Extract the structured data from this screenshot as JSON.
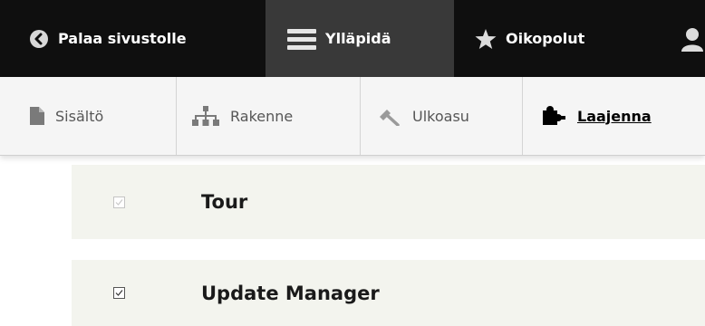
{
  "toolbar": {
    "back_label": "Palaa sivustolle",
    "admin_label": "Ylläpidä",
    "shortcuts_label": "Oikopolut"
  },
  "tray": {
    "items": [
      {
        "label": "Sisältö",
        "icon": "file-icon"
      },
      {
        "label": "Rakenne",
        "icon": "sitemap-icon"
      },
      {
        "label": "Ulkoasu",
        "icon": "wrench-icon"
      },
      {
        "label": "Laajenna",
        "icon": "puzzle-icon",
        "active": true
      }
    ]
  },
  "modules": [
    {
      "name": "Tour",
      "checked": true,
      "disabled": true
    },
    {
      "name": "Update Manager",
      "checked": true,
      "disabled": false
    }
  ],
  "colors": {
    "toolbar_bg": "#0f0f0f",
    "toolbar_active": "#393939",
    "tray_bg": "#f5f5f5",
    "row_bg": "#f3f4ee"
  }
}
